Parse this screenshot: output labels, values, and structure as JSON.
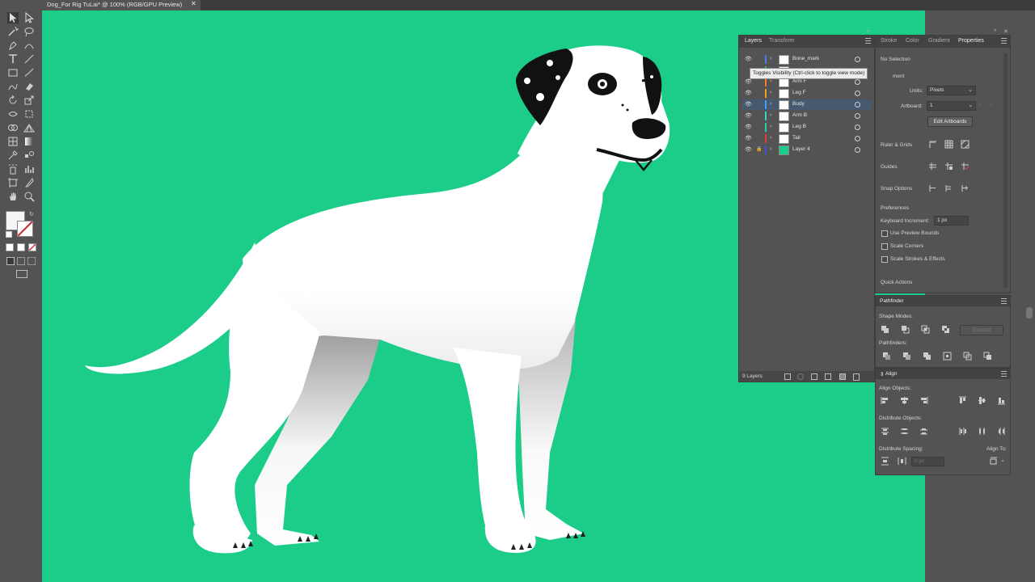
{
  "document": {
    "title": "Dog_For Rig TuLai* @ 100% (RGB/GPU Preview)",
    "close_glyph": "✕"
  },
  "tools": [
    "selection-tool",
    "direct-selection-tool",
    "magic-wand-tool",
    "lasso-tool",
    "pen-tool",
    "curvature-tool",
    "type-tool",
    "line-tool",
    "rectangle-tool",
    "paintbrush-tool",
    "shaper-tool",
    "eraser-tool",
    "rotate-tool",
    "scale-tool",
    "width-tool",
    "free-transform-tool",
    "shape-builder-tool",
    "perspective-grid-tool",
    "mesh-tool",
    "gradient-tool",
    "eyedropper-tool",
    "blend-tool",
    "symbol-sprayer-tool",
    "column-graph-tool",
    "artboard-tool",
    "slice-tool",
    "hand-tool",
    "zoom-tool"
  ],
  "layers_panel": {
    "tabs": [
      "Layers",
      "Transform"
    ],
    "rows": [
      {
        "name": "Bone_mark",
        "color": "#4a7be8"
      },
      {
        "name": "",
        "color": "#31c24f"
      },
      {
        "name": "Arm F",
        "color": "#ff7b2a"
      },
      {
        "name": "Leg F",
        "color": "#f39c21"
      },
      {
        "name": "Body",
        "color": "#3ea3ff"
      },
      {
        "name": "Arm B",
        "color": "#35d6c8"
      },
      {
        "name": "Leg B",
        "color": "#2bd1a0"
      },
      {
        "name": "Tail",
        "color": "#e53b3b"
      },
      {
        "name": "Layer 4",
        "color": "#4d4dd9"
      }
    ],
    "footer_count": "9 Layers",
    "tooltip": "Toggles Visibility (Ctrl-click to toggle view mode)"
  },
  "properties_panel": {
    "tabs": [
      "Stroke",
      "Color",
      "Gradient",
      "Properties"
    ],
    "no_selection": "No Selection",
    "document_label": "ment",
    "units_label": "Units:",
    "units_value": "Pixels",
    "artboard_label": "Artboard:",
    "artboard_value": "1",
    "edit_artboards": "Edit Artboards",
    "ruler_grids": "Ruler & Grids",
    "guides": "Guides",
    "snap_options": "Snap Options",
    "preferences": "Preferences",
    "keyboard_increment_label": "Keyboard Increment:",
    "keyboard_increment_value": "1 px",
    "checkboxes": [
      "Use Preview Bounds",
      "Scale Corners",
      "Scale Strokes & Effects"
    ],
    "quick_actions": "Quick Actions"
  },
  "pathfinder_panel": {
    "title": "Pathfinder",
    "shape_modes": "Shape Modes:",
    "expand": "Expand",
    "pathfinders": "Pathfinders:"
  },
  "align_panel": {
    "title": "Align",
    "align_objects": "Align Objects:",
    "distribute_objects": "Distribute Objects:",
    "distribute_spacing": "Distribute Spacing:",
    "align_to": "Align To:",
    "spacing_value": "0 px"
  },
  "colors": {
    "canvas": "#1ccd8a",
    "ui_bg": "#535353",
    "selected_row": "#46596f"
  }
}
